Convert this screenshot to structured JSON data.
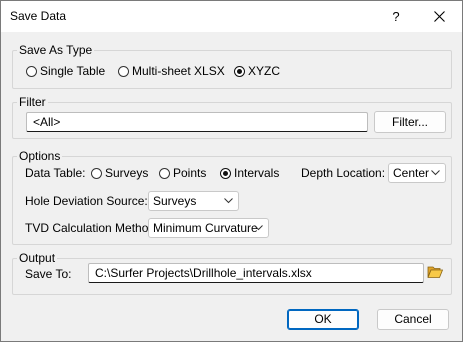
{
  "window": {
    "title": "Save Data",
    "help_label": "?",
    "close_icon": "close-icon"
  },
  "save_as_type": {
    "legend": "Save As Type",
    "options": [
      {
        "label": "Single Table",
        "selected": false
      },
      {
        "label": "Multi-sheet XLSX",
        "selected": false
      },
      {
        "label": "XYZC",
        "selected": true
      }
    ]
  },
  "filter": {
    "legend": "Filter",
    "value": "<All>",
    "button_label": "Filter..."
  },
  "options": {
    "legend": "Options",
    "data_table_label": "Data Table:",
    "data_table_options": [
      {
        "label": "Surveys",
        "selected": false
      },
      {
        "label": "Points",
        "selected": false
      },
      {
        "label": "Intervals",
        "selected": true
      }
    ],
    "depth_location_label": "Depth Location:",
    "depth_location_value": "Center",
    "hole_deviation_label": "Hole Deviation Source:",
    "hole_deviation_value": "Surveys",
    "tvd_label": "TVD Calculation Method:",
    "tvd_value": "Minimum Curvature"
  },
  "output": {
    "legend": "Output",
    "save_to_label": "Save To:",
    "save_to_value": "C:\\Surfer Projects\\Drillhole_intervals.xlsx",
    "browse_icon": "open-folder-icon"
  },
  "footer": {
    "ok_label": "OK",
    "cancel_label": "Cancel"
  },
  "colors": {
    "accent": "#0067c0",
    "background": "#f0f0f0"
  }
}
